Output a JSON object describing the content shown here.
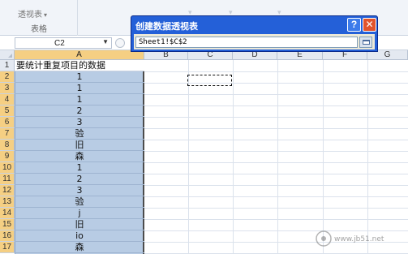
{
  "ribbon": {
    "pivot_table_button": "透视表",
    "group_caption": "表格"
  },
  "formula_bar": {
    "name_box": "C2"
  },
  "sheet": {
    "columns": [
      "A",
      "B",
      "C",
      "D",
      "E",
      "F",
      "G"
    ],
    "rows": [
      {
        "num": "1",
        "a": "要统计重复项目的数据"
      },
      {
        "num": "2",
        "a": "1"
      },
      {
        "num": "3",
        "a": "1"
      },
      {
        "num": "4",
        "a": "1"
      },
      {
        "num": "5",
        "a": "2"
      },
      {
        "num": "6",
        "a": "3"
      },
      {
        "num": "7",
        "a": "验"
      },
      {
        "num": "8",
        "a": "旧"
      },
      {
        "num": "9",
        "a": "森"
      },
      {
        "num": "10",
        "a": "1"
      },
      {
        "num": "11",
        "a": "2"
      },
      {
        "num": "12",
        "a": "3"
      },
      {
        "num": "13",
        "a": "验"
      },
      {
        "num": "14",
        "a": "j"
      },
      {
        "num": "15",
        "a": "旧"
      },
      {
        "num": "16",
        "a": "io"
      },
      {
        "num": "17",
        "a": "森"
      }
    ]
  },
  "dialog": {
    "title": "创建数据透视表",
    "help_glyph": "?",
    "close_glyph": "✕",
    "range_value": "Sheet1!$C$2"
  },
  "watermark": {
    "text": "www.jb51.net"
  }
}
